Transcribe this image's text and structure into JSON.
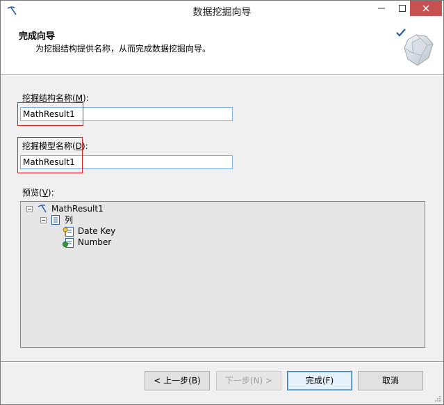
{
  "window": {
    "title": "数据挖掘向导"
  },
  "header": {
    "title": "完成向导",
    "subtitle": "为挖掘结构提供名称，从而完成数据挖掘向导。"
  },
  "form": {
    "structure_label_prefix": "挖掘结构名称(",
    "structure_label_key": "M",
    "structure_label_suffix": "):",
    "structure_value": "MathResult1",
    "model_label_prefix": "挖掘模型名称(",
    "model_label_key": "D",
    "model_label_suffix": "):",
    "model_value": "MathResult1",
    "preview_label_prefix": "预览(",
    "preview_label_key": "V",
    "preview_label_suffix": "):"
  },
  "tree": {
    "root": "MathResult1",
    "columns_node": "列",
    "children": [
      "Date Key",
      "Number"
    ]
  },
  "buttons": {
    "back": "< 上一步(B)",
    "next": "下一步(N) >",
    "finish": "完成(F)",
    "cancel": "取消"
  },
  "colors": {
    "highlight": "#e21c1c",
    "input_border": "#7eb4ea",
    "close_button": "#c75050"
  }
}
